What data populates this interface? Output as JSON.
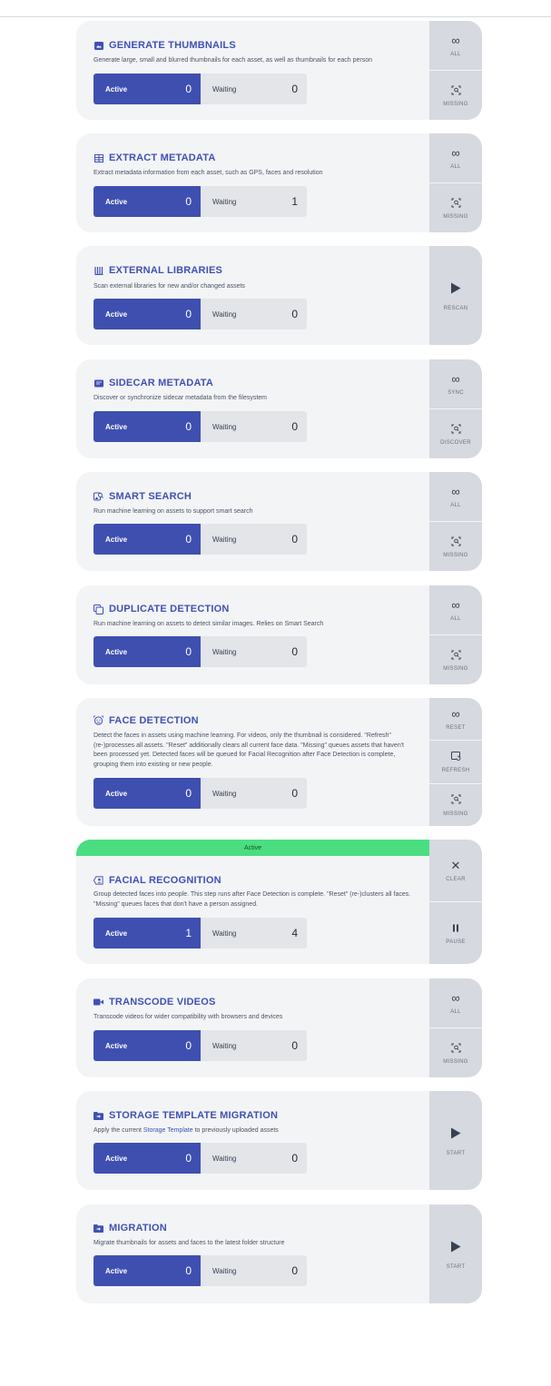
{
  "jobs": [
    {
      "title": "GENERATE THUMBNAILS",
      "icon": "image-icon",
      "description": "Generate large, small and blurred thumbnails for each asset, as well as thumbnails for each person",
      "active_label": "Active",
      "active_count": "0",
      "waiting_label": "Waiting",
      "waiting_count": "0",
      "actions": [
        {
          "label": "ALL",
          "icon": "infinity-icon"
        },
        {
          "label": "MISSING",
          "icon": "missing-icon"
        }
      ]
    },
    {
      "title": "EXTRACT METADATA",
      "icon": "table-icon",
      "description": "Extract metadata information from each asset, such as GPS, faces and resolution",
      "active_label": "Active",
      "active_count": "0",
      "waiting_label": "Waiting",
      "waiting_count": "1",
      "actions": [
        {
          "label": "ALL",
          "icon": "infinity-icon"
        },
        {
          "label": "MISSING",
          "icon": "missing-icon"
        }
      ]
    },
    {
      "title": "EXTERNAL LIBRARIES",
      "icon": "library-icon",
      "description": "Scan external libraries for new and/or changed assets",
      "active_label": "Active",
      "active_count": "0",
      "waiting_label": "Waiting",
      "waiting_count": "0",
      "actions": [
        {
          "label": "RESCAN",
          "icon": "play-icon"
        }
      ]
    },
    {
      "title": "SIDECAR METADATA",
      "icon": "xml-file-icon",
      "description": "Discover or synchronize sidecar metadata from the filesystem",
      "active_label": "Active",
      "active_count": "0",
      "waiting_label": "Waiting",
      "waiting_count": "0",
      "actions": [
        {
          "label": "SYNC",
          "icon": "infinity-icon"
        },
        {
          "label": "DISCOVER",
          "icon": "missing-icon"
        }
      ]
    },
    {
      "title": "SMART SEARCH",
      "icon": "image-search-icon",
      "description": "Run machine learning on assets to support smart search",
      "active_label": "Active",
      "active_count": "0",
      "waiting_label": "Waiting",
      "waiting_count": "0",
      "actions": [
        {
          "label": "ALL",
          "icon": "infinity-icon"
        },
        {
          "label": "MISSING",
          "icon": "missing-icon"
        }
      ]
    },
    {
      "title": "DUPLICATE DETECTION",
      "icon": "duplicate-icon",
      "description": "Run machine learning on assets to detect similar images. Relies on Smart Search",
      "active_label": "Active",
      "active_count": "0",
      "waiting_label": "Waiting",
      "waiting_count": "0",
      "actions": [
        {
          "label": "ALL",
          "icon": "infinity-icon"
        },
        {
          "label": "MISSING",
          "icon": "missing-icon"
        }
      ]
    },
    {
      "title": "FACE DETECTION",
      "icon": "face-icon",
      "description": "Detect the faces in assets using machine learning. For videos, only the thumbnail is considered. \"Refresh\" (re-)processes all assets. \"Reset\" additionally clears all current face data. \"Missing\" queues assets that haven't been processed yet. Detected faces will be queued for Facial Recognition after Face Detection is complete, grouping them into existing or new people.",
      "active_label": "Active",
      "active_count": "0",
      "waiting_label": "Waiting",
      "waiting_count": "0",
      "actions": [
        {
          "label": "RESET",
          "icon": "infinity-icon"
        },
        {
          "label": "REFRESH",
          "icon": "refresh-icon"
        },
        {
          "label": "MISSING",
          "icon": "missing-icon"
        }
      ]
    },
    {
      "title": "FACIAL RECOGNITION",
      "icon": "face-tag-icon",
      "status": "Active",
      "description": "Group detected faces into people. This step runs after Face Detection is complete. \"Reset\" (re-)clusters all faces. \"Missing\" queues faces that don't have a person assigned.",
      "active_label": "Active",
      "active_count": "1",
      "waiting_label": "Waiting",
      "waiting_count": "4",
      "actions": [
        {
          "label": "CLEAR",
          "icon": "close-icon"
        },
        {
          "label": "PAUSE",
          "icon": "pause-icon"
        }
      ]
    },
    {
      "title": "TRANSCODE VIDEOS",
      "icon": "video-icon",
      "description": "Transcode videos for wider compatibility with browsers and devices",
      "active_label": "Active",
      "active_count": "0",
      "waiting_label": "Waiting",
      "waiting_count": "0",
      "actions": [
        {
          "label": "ALL",
          "icon": "infinity-icon"
        },
        {
          "label": "MISSING",
          "icon": "missing-icon"
        }
      ]
    },
    {
      "title": "STORAGE TEMPLATE MIGRATION",
      "icon": "folder-move-icon",
      "description_prefix": "Apply the current ",
      "description_link": "Storage Template",
      "description_suffix": " to previously uploaded assets",
      "active_label": "Active",
      "active_count": "0",
      "waiting_label": "Waiting",
      "waiting_count": "0",
      "actions": [
        {
          "label": "START",
          "icon": "play-icon"
        }
      ]
    },
    {
      "title": "MIGRATION",
      "icon": "folder-move-icon",
      "description": "Migrate thumbnails for assets and faces to the latest folder structure",
      "active_label": "Active",
      "active_count": "0",
      "waiting_label": "Waiting",
      "waiting_count": "0",
      "actions": [
        {
          "label": "START",
          "icon": "play-icon"
        }
      ]
    }
  ]
}
